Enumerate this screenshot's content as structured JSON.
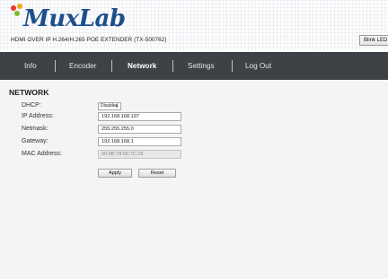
{
  "header": {
    "logo_text": "MuxLab",
    "subtitle": "HDMI OVER IP H.264/H.265 POE EXTENDER (TX-500762)",
    "blink_label": "Blink LED"
  },
  "nav": {
    "items": [
      {
        "label": "Info",
        "active": false
      },
      {
        "label": "Encoder",
        "active": false
      },
      {
        "label": "Network",
        "active": true
      },
      {
        "label": "Settings",
        "active": false
      },
      {
        "label": "Log Out",
        "active": false
      }
    ]
  },
  "network": {
    "title": "NETWORK",
    "dhcp_label": "DHCP:",
    "dhcp_value": "Disabled",
    "ip_label": "IP Address:",
    "ip_value": "192.168.168.197",
    "netmask_label": "Netmask:",
    "netmask_value": "255.255.255.0",
    "gateway_label": "Gateway:",
    "gateway_value": "192.168.168.1",
    "mac_label": "MAC Address:",
    "mac_value": "00:0B:78:00:7C:26",
    "apply_label": "Apply",
    "reset_label": "Reset"
  },
  "colors": {
    "brand_blue": "#1d4f8c",
    "nav_bg": "#3e4247",
    "content_bg": "#f4f4f4",
    "logo_dots": [
      "#e63b2e",
      "#f2a81d",
      "#7bbd2a"
    ]
  }
}
